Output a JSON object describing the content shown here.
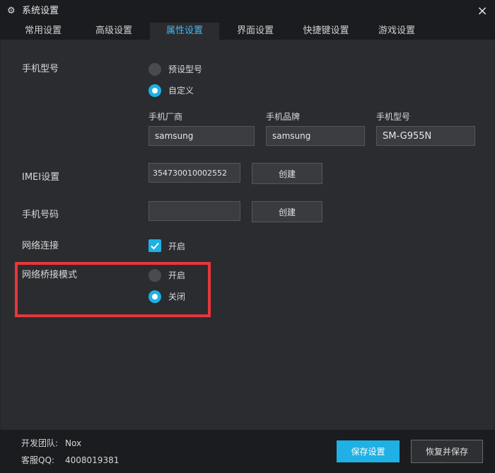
{
  "window": {
    "title": "系统设置",
    "icon": "gear-icon",
    "close_label": "×"
  },
  "tabs": [
    {
      "label": "常用设置",
      "active": false
    },
    {
      "label": "高级设置",
      "active": false
    },
    {
      "label": "属性设置",
      "active": true
    },
    {
      "label": "界面设置",
      "active": false
    },
    {
      "label": "快捷键设置",
      "active": false
    },
    {
      "label": "游戏设置",
      "active": false
    }
  ],
  "phone_model": {
    "label": "手机型号",
    "options": [
      {
        "label": "预设型号",
        "selected": false
      },
      {
        "label": "自定义",
        "selected": true
      }
    ],
    "fields": [
      {
        "label": "手机厂商",
        "value": "samsung"
      },
      {
        "label": "手机品牌",
        "value": "samsung"
      },
      {
        "label": "手机型号",
        "value": "SM-G955N"
      }
    ]
  },
  "imei": {
    "label": "IMEI设置",
    "value": "354730010002552",
    "button": "创建"
  },
  "phone_number": {
    "label": "手机号码",
    "value": "",
    "button": "创建"
  },
  "network": {
    "label": "网络连接",
    "checkbox_label": "开启",
    "checked": true
  },
  "bridge_mode": {
    "label": "网络桥接模式",
    "options": [
      {
        "label": "开启",
        "selected": false
      },
      {
        "label": "关闭",
        "selected": true
      }
    ]
  },
  "footer": {
    "team_label": "开发团队:",
    "team_value": "Nox",
    "qq_label": "客服QQ:",
    "qq_value": "4008019381",
    "save_button": "保存设置",
    "restore_button": "恢复并保存"
  },
  "colors": {
    "accent": "#1fb1e6",
    "active_tab_text": "#3fb6f0",
    "highlight_border": "#e8363a",
    "background": "#2b2c30",
    "chrome": "#1b1c1f"
  }
}
